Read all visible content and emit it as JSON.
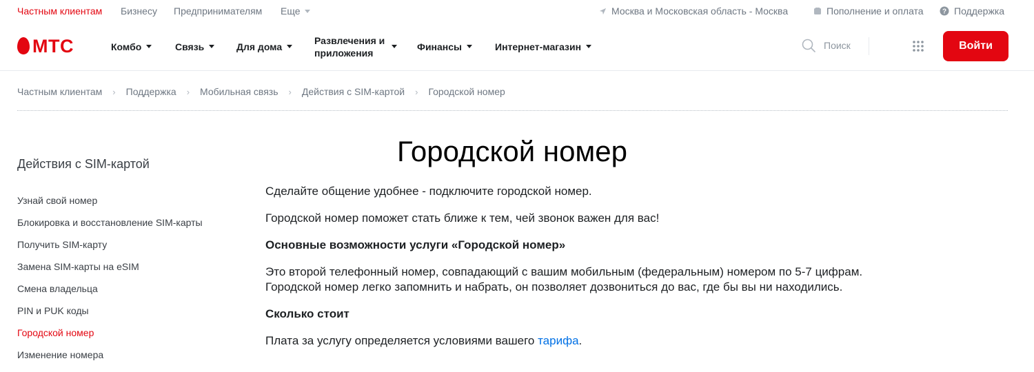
{
  "topbar": {
    "segments": [
      "Частным клиентам",
      "Бизнесу",
      "Предпринимателям",
      "Еще"
    ],
    "region": "Москва и Московская область - Москва",
    "payment": "Пополнение и оплата",
    "support": "Поддержка"
  },
  "header": {
    "logo": "МТС",
    "nav": [
      "Комбо",
      "Связь",
      "Для дома",
      "Развлечения и приложения",
      "Финансы",
      "Интернет-магазин"
    ],
    "search_label": "Поиск",
    "login_label": "Войти"
  },
  "breadcrumb": [
    "Частным клиентам",
    "Поддержка",
    "Мобильная связь",
    "Действия с SIM-картой",
    "Городской номер"
  ],
  "sidebar": {
    "title": "Действия с SIM-картой",
    "items": [
      "Узнай свой номер",
      "Блокировка и восстановление SIM-карты",
      "Получить SIM-карту",
      "Замена SIM-карты на eSIM",
      "Смена владельца",
      "PIN и PUK коды",
      "Городской номер",
      "Изменение номера"
    ],
    "active_index": 6
  },
  "main": {
    "title": "Городской номер",
    "intro1": "Сделайте общение удобнее - подключите городской номер.",
    "intro2": "Городской номер поможет стать ближе к тем, чей звонок важен для вас!",
    "h_features": "Основные возможности услуги «Городской номер»",
    "features_line1": "Это второй телефонный номер, совпадающий с вашим мобильным (федеральным) номером по 5-7 цифрам.",
    "features_line2": "Городской номер легко запомнить и набрать, он позволяет дозвониться до вас, где бы вы ни находились.",
    "h_price": "Сколько стоит",
    "price_text": "Плата за услугу определяется условиями вашего ",
    "price_link": "тарифа",
    "price_end": "."
  },
  "colors": {
    "brand_red": "#e30611",
    "link_blue": "#0070e5",
    "muted_text": "#6e7782"
  },
  "icons": [
    "location-arrow-icon",
    "wallet-icon",
    "question-icon",
    "search-icon",
    "apps-grid-icon",
    "mts-egg-logo-icon",
    "chevron-right-icon"
  ]
}
